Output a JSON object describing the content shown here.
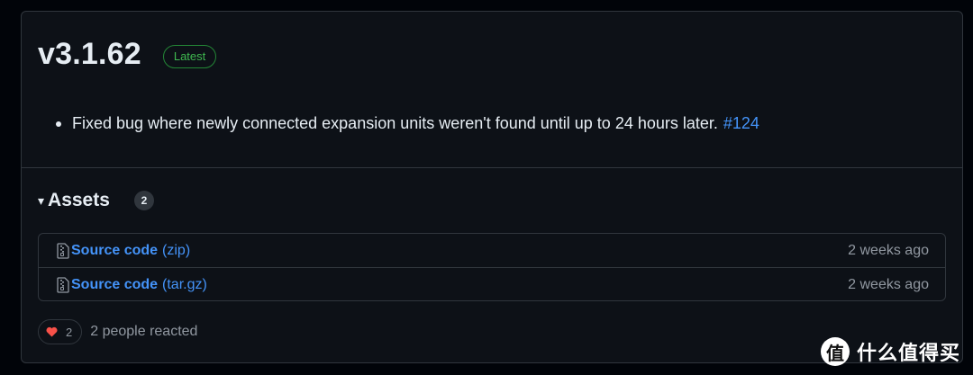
{
  "release": {
    "version": "v3.1.62",
    "badge": "Latest",
    "notes": [
      {
        "text": "Fixed bug where newly connected expansion units weren't found until up to 24 hours later.",
        "link": "#124"
      }
    ]
  },
  "assets": {
    "caret": "▾",
    "title": "Assets",
    "count": "2",
    "items": [
      {
        "icon": "file-zip-icon",
        "name": "Source code",
        "ext": "(zip)",
        "date": "2 weeks ago"
      },
      {
        "icon": "file-zip-icon",
        "name": "Source code",
        "ext": "(tar.gz)",
        "date": "2 weeks ago"
      }
    ]
  },
  "reactions": {
    "icon": "heart-icon",
    "count": "2",
    "summary": "2 people reacted"
  },
  "watermark": {
    "logo": "值",
    "text": "什么值得买"
  },
  "colors": {
    "link": "#4493f8",
    "badge_green": "#3fb950",
    "heart": "#f85149",
    "background": "#0d1117",
    "border": "#30363d"
  }
}
